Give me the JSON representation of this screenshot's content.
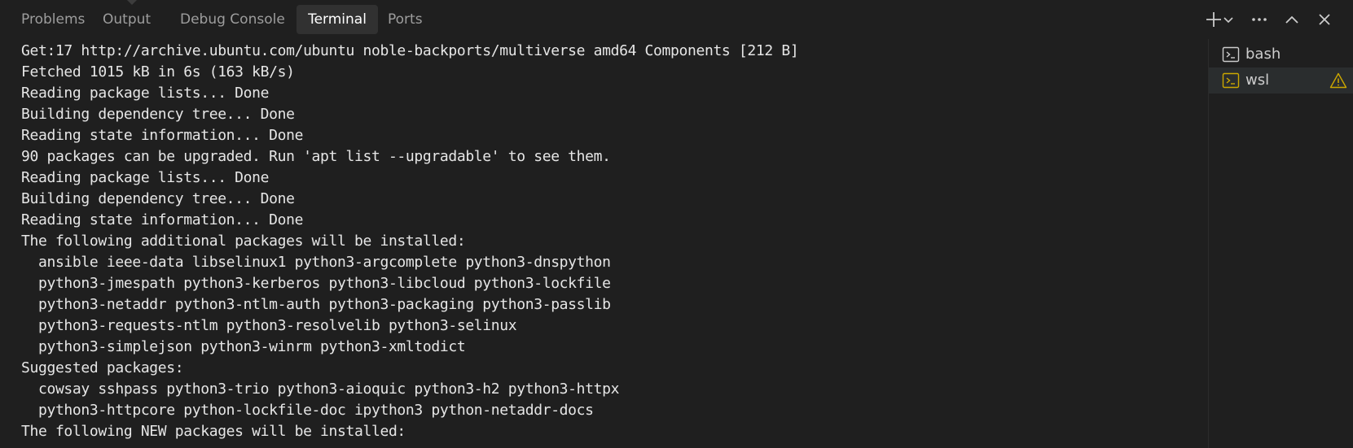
{
  "panel": {
    "tabs": [
      {
        "label": "Problems"
      },
      {
        "label": "Output"
      },
      {
        "label": "Debug Console"
      },
      {
        "label": "Terminal"
      },
      {
        "label": "Ports"
      }
    ],
    "active_tab": "Terminal",
    "actions": [
      "plus-icon",
      "chevron-down-icon",
      "more-icon",
      "chevron-up-icon",
      "close-icon"
    ]
  },
  "terminal": {
    "lines": [
      "Get:17 http://archive.ubuntu.com/ubuntu noble-backports/multiverse amd64 Components [212 B]",
      "Fetched 1015 kB in 6s (163 kB/s)",
      "Reading package lists... Done",
      "Building dependency tree... Done",
      "Reading state information... Done",
      "90 packages can be upgraded. Run 'apt list --upgradable' to see them.",
      "Reading package lists... Done",
      "Building dependency tree... Done",
      "Reading state information... Done",
      "The following additional packages will be installed:",
      "  ansible ieee-data libselinux1 python3-argcomplete python3-dnspython",
      "  python3-jmespath python3-kerberos python3-libcloud python3-lockfile",
      "  python3-netaddr python3-ntlm-auth python3-packaging python3-passlib",
      "  python3-requests-ntlm python3-resolvelib python3-selinux",
      "  python3-simplejson python3-winrm python3-xmltodict",
      "Suggested packages:",
      "  cowsay sshpass python3-trio python3-aioquic python3-h2 python3-httpx",
      "  python3-httpcore python-lockfile-doc ipython3 python-netaddr-docs",
      "The following NEW packages will be installed:"
    ]
  },
  "terminal_list": {
    "items": [
      {
        "label": "bash",
        "icon": "terminal-icon",
        "selected": false,
        "warning": false
      },
      {
        "label": "wsl",
        "icon": "terminal-icon",
        "selected": true,
        "warning": true
      }
    ]
  },
  "colors": {
    "background": "#1f1f1f",
    "active_tab_bg": "#313131",
    "terminal_text": "#e6e6e6",
    "warning": "#cca700"
  }
}
